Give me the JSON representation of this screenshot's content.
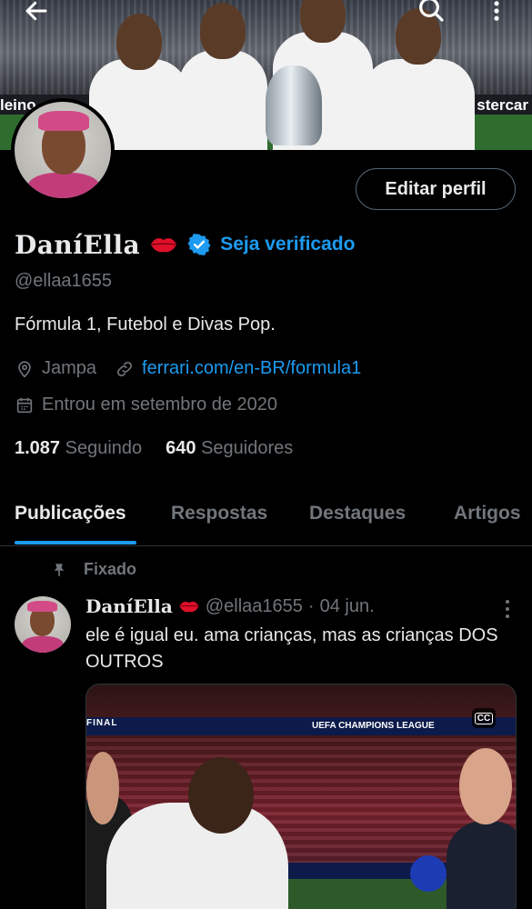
{
  "header": {
    "banner_board_left": "leino",
    "banner_board_right": "stercar",
    "icons": {
      "back": "arrow-left-icon",
      "search": "search-icon",
      "more": "more-vertical-icon"
    }
  },
  "profile": {
    "display_name": "DaníElla",
    "name_emoji": "lips-emoji",
    "verified_badge": "verified-badge-icon",
    "get_verified_label": "Seja verificado",
    "handle": "@ellaa1655",
    "bio": "Fórmula 1, Futebol e Divas Pop.",
    "location": "Jampa",
    "website": "ferrari.com/en-BR/formula1",
    "joined": "Entrou em setembro de 2020",
    "edit_profile_label": "Editar perfil",
    "following_count": "1.087",
    "following_label": "Seguindo",
    "followers_count": "640",
    "followers_label": "Seguidores"
  },
  "tabs": [
    {
      "label": "Publicações",
      "active": true
    },
    {
      "label": "Respostas",
      "active": false
    },
    {
      "label": "Destaques",
      "active": false
    },
    {
      "label": "Artigos",
      "active": false
    }
  ],
  "pinned_post": {
    "pinned_label": "Fixado",
    "author_name": "DaníElla",
    "author_handle": "@ellaa1655",
    "separator": "·",
    "date": "04 jun.",
    "text": "ele é igual eu. ama crianças, mas as crianças DOS OUTROS",
    "media": {
      "board_final": "FINAL",
      "board_ucl": "UEFA CHAMPIONS LEAGUE",
      "cc_label": "CC"
    }
  },
  "colors": {
    "background": "#000000",
    "accent": "#1d9bf0",
    "text_primary": "#e7e9ea",
    "text_secondary": "#71767b",
    "border": "#2f3336"
  }
}
